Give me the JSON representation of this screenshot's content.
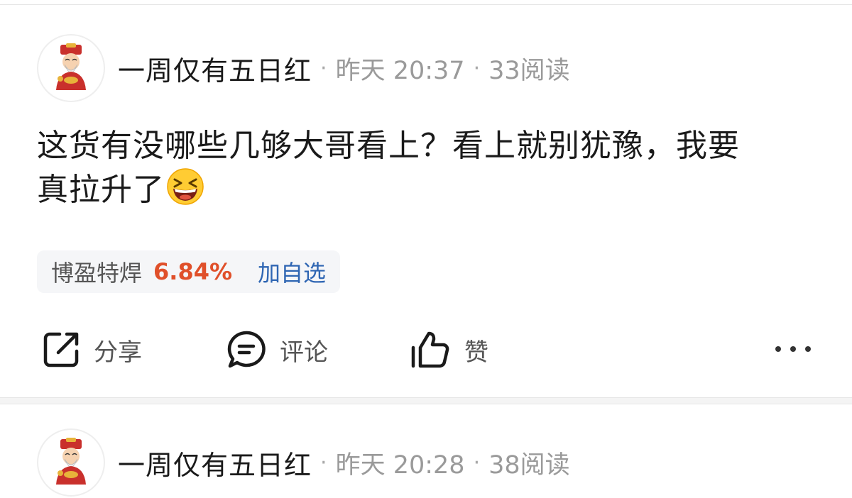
{
  "posts": [
    {
      "username": "一周仅有五日红",
      "time": "昨天 20:37",
      "reads": "33阅读",
      "content": "这货有没哪些几够大哥看上？看上就别犹豫，我要真拉升了",
      "emoji": "grinning-squinting-face",
      "stock": {
        "name": "博盈特焊",
        "change": "6.84%",
        "add_label": "加自选"
      },
      "actions": {
        "share_label": "分享",
        "comment_label": "评论",
        "like_label": "赞"
      }
    },
    {
      "username": "一周仅有五日红",
      "time": "昨天 20:28",
      "reads": "38阅读"
    }
  ],
  "icons": {
    "avatar": "god-of-wealth-avatar",
    "share": "share-icon",
    "comment": "comment-icon",
    "like": "thumbs-up-icon",
    "more": "more-dots-icon"
  },
  "colors": {
    "stock_change": "#e0502a",
    "add_watch": "#2f66b3",
    "meta_text": "#9a9a9a"
  }
}
